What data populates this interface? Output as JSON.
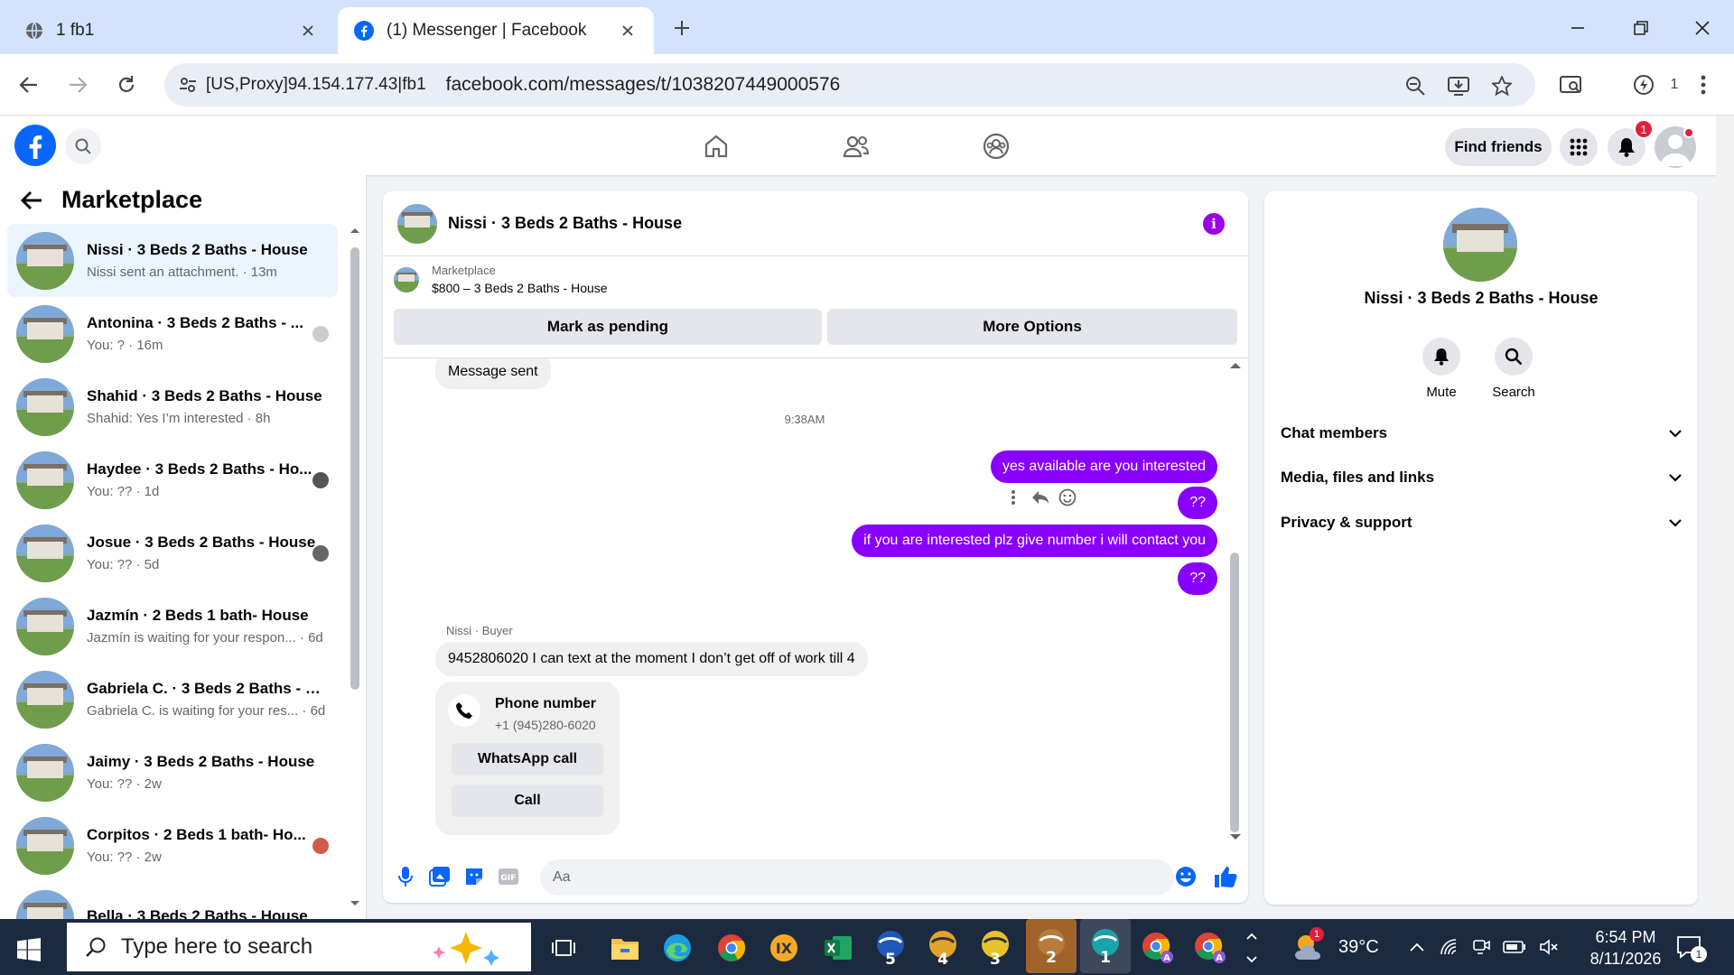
{
  "browser": {
    "tabs": [
      {
        "label": "1 fb1"
      },
      {
        "label": "(1) Messenger | Facebook"
      }
    ],
    "proxy_label": "[US,Proxy]94.154.177.43|fb1",
    "url": "facebook.com/messages/t/1038207449000576",
    "extension_count": "1"
  },
  "fb_header": {
    "find_friends": "Find friends",
    "notification_count": "1"
  },
  "sidebar": {
    "title": "Marketplace",
    "conversations": [
      {
        "name": "Nissi · 3 Beds 2 Baths - House",
        "preview": "Nissi sent an attachment. · 13m",
        "active": true
      },
      {
        "name": "Antonina · 3 Beds 2 Baths - ...",
        "preview": "You: ? · 16m"
      },
      {
        "name": "Shahid · 3 Beds 2 Baths - House",
        "preview": "Shahid: Yes I’m interested · 8h"
      },
      {
        "name": "Haydee · 3 Beds 2 Baths - Ho...",
        "preview": "You: ?? · 1d"
      },
      {
        "name": "Josue · 3 Beds 2 Baths - House",
        "preview": "You: ?? · 5d"
      },
      {
        "name": "Jazmín · 2 Beds 1 bath- House",
        "preview": "Jazmín is waiting for your respon... · 6d"
      },
      {
        "name": "Gabriela C. · 3 Beds 2 Baths - H...",
        "preview": "Gabriela C. is waiting for your res... · 6d"
      },
      {
        "name": "Jaimy · 3 Beds 2 Baths - House",
        "preview": "You: ?? · 2w"
      },
      {
        "name": "Corpitos · 2 Beds 1 bath- Ho...",
        "preview": "You: ?? · 2w"
      },
      {
        "name": "Bella · 3 Beds 2 Baths - House",
        "preview": ""
      }
    ]
  },
  "chat": {
    "title": "Nissi · 3 Beds 2 Baths - House",
    "marketplace_label": "Marketplace",
    "listing": "$800 – 3 Beds 2 Baths - House",
    "mark_pending": "Mark as pending",
    "more_options": "More Options",
    "messages": {
      "sent_system": "Message sent",
      "timestamp": "9:38AM",
      "out1": "yes available are you interested",
      "out2": "??",
      "out3": "if you are interested plz give number i will contact you",
      "out4": "??",
      "sender_label": "Nissi · Buyer",
      "in1": "9452806020 I can text at the moment I don’t get off of work till 4",
      "card_title": "Phone number",
      "card_number": "+1 (945)280-6020",
      "whatsapp": "WhatsApp call",
      "call": "Call"
    },
    "composer_placeholder": "Aa"
  },
  "right_panel": {
    "name": "Nissi · 3 Beds 2 Baths - House",
    "mute": "Mute",
    "search": "Search",
    "rows": [
      "Chat members",
      "Media, files and links",
      "Privacy & support"
    ]
  },
  "taskbar": {
    "search_placeholder": "Type here to search",
    "weather": "39°C",
    "weather_badge": "1",
    "time": "6:54 PM",
    "date": "8/11/2026",
    "notif_count": "1",
    "apps": [
      "5",
      "4",
      "3",
      "2",
      "1"
    ]
  },
  "colors": {
    "messenger_purple": "#8a00ff",
    "fb_blue": "#0866ff",
    "badge_red": "#e41e3f"
  }
}
